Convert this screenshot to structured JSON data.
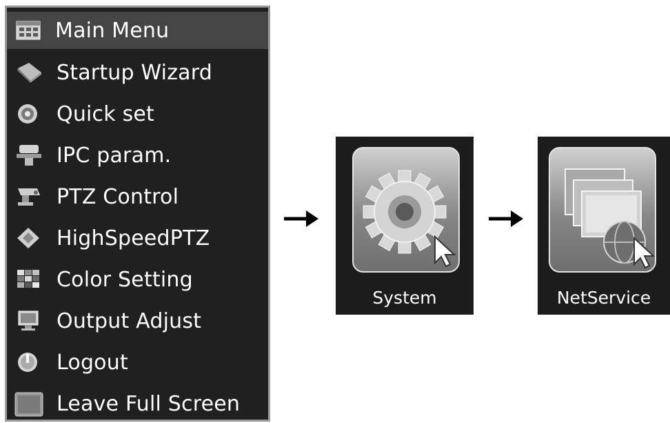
{
  "menu": {
    "items": [
      {
        "label": "Main Menu",
        "icon": "main-menu-grid-icon"
      },
      {
        "label": "Startup Wizard",
        "icon": "wizard-icon"
      },
      {
        "label": "Quick set",
        "icon": "quick-set-icon"
      },
      {
        "label": "IPC param.",
        "icon": "ipc-camera-icon"
      },
      {
        "label": "PTZ Control",
        "icon": "ptz-camera-icon"
      },
      {
        "label": "HighSpeedPTZ",
        "icon": "highspeed-ptz-icon"
      },
      {
        "label": "Color Setting",
        "icon": "color-palette-icon"
      },
      {
        "label": "Output Adjust",
        "icon": "monitor-icon"
      },
      {
        "label": "Logout",
        "icon": "logout-icon"
      },
      {
        "label": "Leave Full Screen",
        "icon": "leave-fullscreen-icon"
      }
    ]
  },
  "tiles": {
    "system": {
      "label": "System",
      "icon": "gear-icon"
    },
    "netservice": {
      "label": "NetService",
      "icon": "network-globe-icon"
    }
  },
  "colors": {
    "menu_bg": "#202020",
    "highlight": "#454545",
    "text": "#ffffff"
  }
}
